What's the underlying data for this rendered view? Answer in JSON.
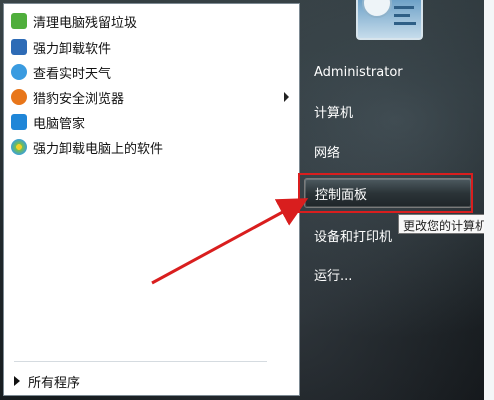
{
  "start_menu": {
    "programs": [
      {
        "label": "清理电脑残留垃圾",
        "icon": "broom-recycle-icon",
        "color": "#4fae3c"
      },
      {
        "label": "强力卸载软件",
        "icon": "shield-uninstall-icon",
        "color": "#2d6bb6"
      },
      {
        "label": "查看实时天气",
        "icon": "cloud-weather-icon",
        "color": "#3a9be0"
      },
      {
        "label": "猎豹安全浏览器",
        "icon": "cheetah-browser-icon",
        "color": "#e8761a"
      },
      {
        "label": "电脑管家",
        "icon": "shield-manager-icon",
        "color": "#1f86d8"
      },
      {
        "label": "强力卸载电脑上的软件",
        "icon": "flower-uninstall-icon",
        "color": "#7cc242"
      }
    ],
    "all_programs": "所有程序",
    "right_items": [
      {
        "label": "Administrator"
      },
      {
        "label": "计算机"
      },
      {
        "label": "网络"
      },
      {
        "label": "控制面板"
      },
      {
        "label": "设备和打印机"
      },
      {
        "label": "运行..."
      }
    ],
    "tooltip": "更改您的计算机"
  },
  "annotation": {
    "color": "#d91e1e"
  }
}
